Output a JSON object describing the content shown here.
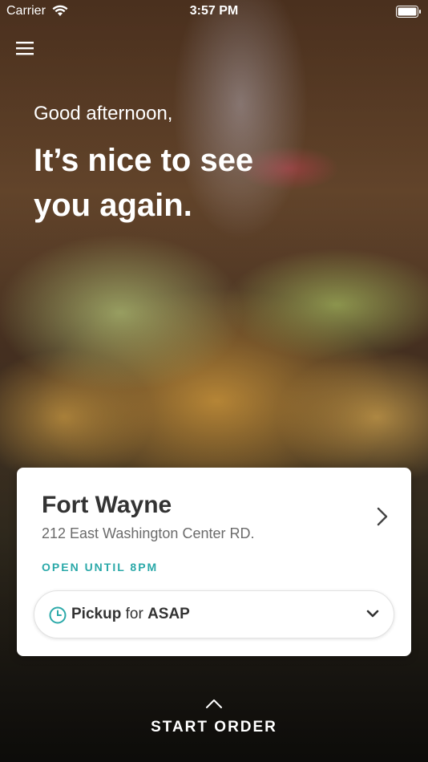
{
  "status_bar": {
    "carrier": "Carrier",
    "time": "3:57 PM"
  },
  "hero": {
    "greeting": "Good afternoon,",
    "headline": "It’s nice to see you again."
  },
  "location": {
    "name": "Fort Wayne",
    "address": "212 East Washington Center RD.",
    "hours": "OPEN UNTIL 8PM",
    "accent_color": "#2ba9a9"
  },
  "pickup": {
    "mode": "Pickup",
    "connector": "for",
    "time": "ASAP"
  },
  "cta": {
    "label": "START ORDER"
  }
}
